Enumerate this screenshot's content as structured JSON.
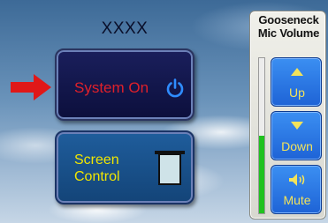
{
  "title": "XXXX",
  "system_button": {
    "label": "System On",
    "icon": "power-icon",
    "label_color": "#e0202a"
  },
  "screen_button": {
    "label_line1": "Screen",
    "label_line2": "Control",
    "icon": "projector-screen-icon",
    "label_color": "#f1e600"
  },
  "pointer": {
    "icon": "red-arrow-icon",
    "color": "#e01818"
  },
  "mic_panel": {
    "title_line1": "Gooseneck",
    "title_line2": "Mic Volume",
    "level_fraction": 0.5,
    "level_color": "#1fc21f",
    "up_label": "Up",
    "down_label": "Down",
    "mute_label": "Mute",
    "up_icon": "triangle-up-icon",
    "down_icon": "triangle-down-icon",
    "mute_icon": "speaker-icon"
  }
}
